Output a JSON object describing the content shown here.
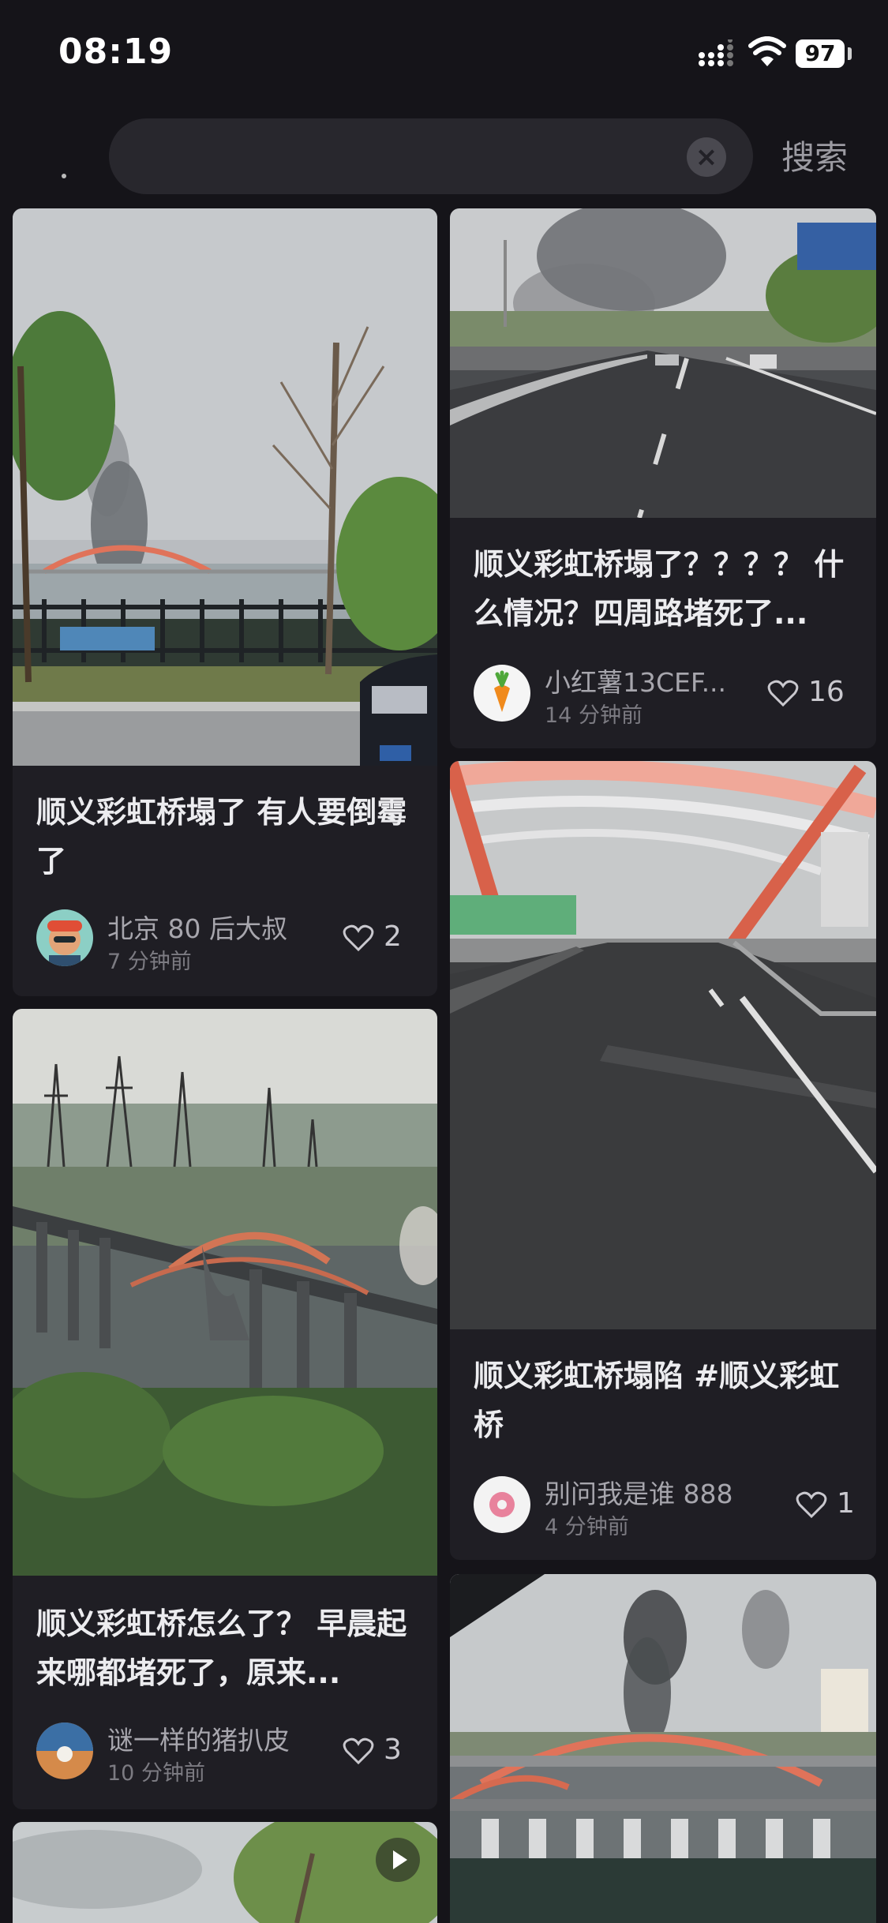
{
  "status_bar": {
    "time": "08:19",
    "battery": "97"
  },
  "search": {
    "value": "",
    "clear_icon": "close-icon",
    "button_label": "搜索"
  },
  "feed": [
    {
      "title": "顺义彩虹桥塌了 有人要倒霉了",
      "author": "北京 80 后大叔",
      "time": "7 分钟前",
      "likes": "2"
    },
    {
      "title": "顺义彩虹桥塌了？？？？ 什么情况？四周路堵死了...",
      "author": "小红薯13CEF...",
      "time": "14 分钟前",
      "likes": "16"
    },
    {
      "title": "顺义彩虹桥怎么了？ 早晨起来哪都堵死了，原来...",
      "author": "谜一样的猪扒皮",
      "time": "10 分钟前",
      "likes": "3"
    },
    {
      "title": "顺义彩虹桥塌陷 #顺义彩虹桥",
      "author": "别问我是谁 888",
      "time": "4 分钟前",
      "likes": "1"
    }
  ],
  "colors": {
    "background": "#151419",
    "card": "#1f1e24",
    "bridge_arch": "#e0735a"
  }
}
